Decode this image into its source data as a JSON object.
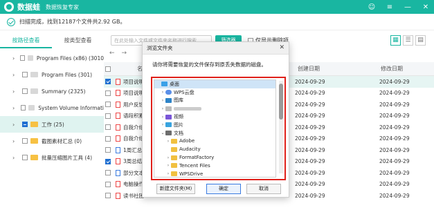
{
  "app": {
    "name": "数据蛙",
    "subtitle": "数据恢复专家",
    "window_controls": [
      "☺",
      "≡",
      "—",
      "✕"
    ]
  },
  "status": {
    "text": "扫描完成，找到12187个文件共2.92 GB。"
  },
  "tabs": [
    "按路径查看",
    "按类型查看"
  ],
  "toolbar": {
    "search_placeholder": "在此处输入文件或文件夹名称进行搜索",
    "filter_label": "筛选器",
    "show_deleted_label": "仅显示删除项"
  },
  "tree": [
    {
      "label": "Program Files (x86) (3010",
      "expanded": false,
      "checked": false,
      "gray": true
    },
    {
      "label": "Program Files (301)",
      "expanded": false,
      "checked": false,
      "gray": true
    },
    {
      "label": "Summary (2325)",
      "expanded": false,
      "checked": false,
      "gray": true
    },
    {
      "label": "System Volume Informati",
      "expanded": false,
      "checked": false,
      "gray": true
    },
    {
      "label": "工作 (25)",
      "expanded": true,
      "checked": "partial",
      "gray": false,
      "selected": true
    },
    {
      "label": "截图素材汇总 (0)",
      "expanded": false,
      "checked": false,
      "gray": false
    },
    {
      "label": "批量压缩图片工具 (4)",
      "expanded": false,
      "checked": false,
      "gray": false
    }
  ],
  "list": {
    "columns": {
      "name": "名",
      "created": "创建日期",
      "modified": "修改日期"
    },
    "rows": [
      {
        "name": "项目说明书",
        "created": "2024-09-29",
        "modified": "2024-09-29",
        "checked": true,
        "selected": true,
        "icon": "red"
      },
      {
        "name": "项目说明书",
        "created": "2024-09-29",
        "modified": "2024-09-29",
        "checked": false,
        "icon": "red"
      },
      {
        "name": "用户反馈表",
        "created": "2024-09-29",
        "modified": "2024-09-29",
        "checked": false,
        "icon": "red"
      },
      {
        "name": "语段积累",
        "created": "2024-09-29",
        "modified": "2024-09-29",
        "checked": false,
        "icon": "red"
      },
      {
        "name": "自我介绍",
        "created": "2024-09-29",
        "modified": "2024-09-29",
        "checked": false,
        "icon": "red"
      },
      {
        "name": "自我介绍",
        "created": "2024-09-29",
        "modified": "2024-09-29",
        "checked": false,
        "icon": "red"
      },
      {
        "name": "1周汇总",
        "created": "2024-09-29",
        "modified": "2024-09-29",
        "checked": false,
        "icon": "blue"
      },
      {
        "name": "3周总结",
        "created": "2024-09-29",
        "modified": "2024-09-29",
        "checked": true,
        "icon": "red"
      },
      {
        "name": "部分文本",
        "created": "2024-09-29",
        "modified": "2024-09-29",
        "checked": false,
        "icon": "blue"
      },
      {
        "name": "电脑操作",
        "created": "2024-09-29",
        "modified": "2024-09-29",
        "checked": false,
        "icon": "red"
      },
      {
        "name": "读书社团",
        "created": "2024-09-29",
        "modified": "2024-09-29",
        "checked": false,
        "icon": "red"
      }
    ]
  },
  "dialog": {
    "title": "浏览文件夹",
    "close": "✕",
    "message": "请你将需要恢复的文件保存到原丢失数据的磁盘。",
    "tree": [
      {
        "label": "桌面",
        "icon": "desk",
        "arrow": "",
        "indent": 0,
        "selected": true
      },
      {
        "label": "WPS云盘",
        "icon": "cloud",
        "arrow": "›",
        "indent": 1
      },
      {
        "label": "图库",
        "icon": "img",
        "arrow": "›",
        "indent": 1
      },
      {
        "label": "",
        "icon": "blur",
        "arrow": "›",
        "indent": 1,
        "blurred": true
      },
      {
        "label": "视频",
        "icon": "video",
        "arrow": "›",
        "indent": 1
      },
      {
        "label": "图片",
        "icon": "pic",
        "arrow": "›",
        "indent": 1
      },
      {
        "label": "文档",
        "icon": "doc",
        "arrow": "⌄",
        "indent": 1
      },
      {
        "label": "Adobe",
        "icon": "fold",
        "arrow": "›",
        "indent": 2
      },
      {
        "label": "Audacity",
        "icon": "fold",
        "arrow": "",
        "indent": 2
      },
      {
        "label": "FormatFactory",
        "icon": "fold",
        "arrow": "›",
        "indent": 2
      },
      {
        "label": "Tencent Files",
        "icon": "fold",
        "arrow": "›",
        "indent": 2
      },
      {
        "label": "WPSDrive",
        "icon": "fold",
        "arrow": "›",
        "indent": 2
      }
    ],
    "buttons": {
      "new_folder": "新建文件夹(M)",
      "ok": "确定",
      "cancel": "取消"
    }
  }
}
